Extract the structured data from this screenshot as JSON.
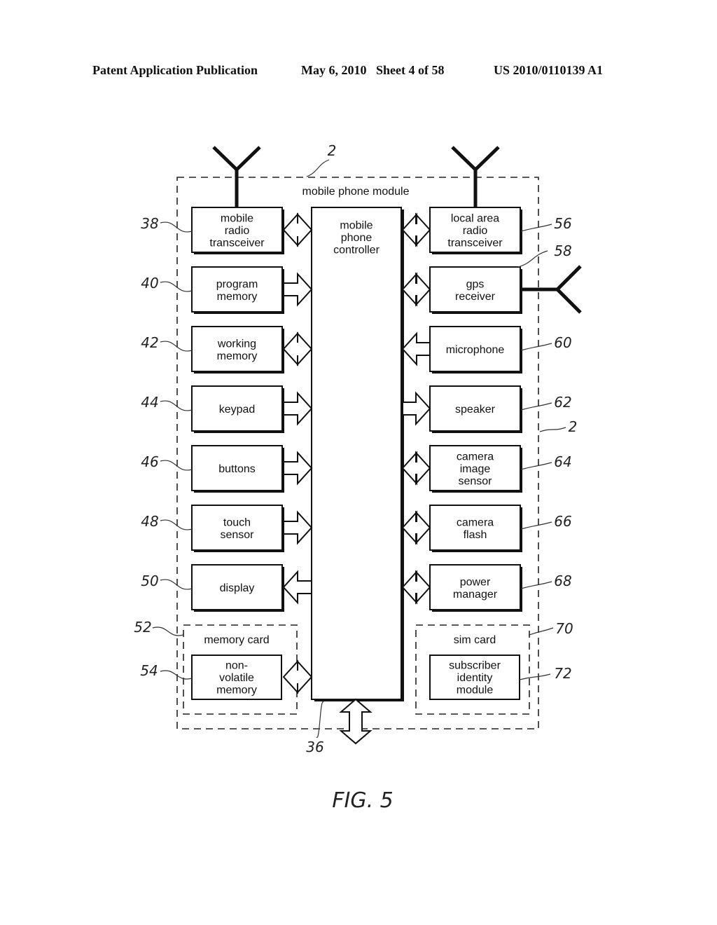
{
  "header": {
    "left": "Patent Application Publication",
    "date_sheet": "May 6, 2010   Sheet 4 of 58",
    "pub_number": "US 2010/0110139 A1"
  },
  "figure": {
    "caption": "FIG. 5",
    "module_title": "mobile phone module",
    "module_ref": "2",
    "module_ref_side": "2",
    "controller": {
      "lines": [
        "mobile",
        "phone",
        "controller"
      ],
      "ref": "36"
    },
    "left_blocks": [
      {
        "lines": [
          "mobile",
          "radio",
          "transceiver"
        ],
        "ref": "38",
        "arrow": "bidirectional",
        "antenna": true
      },
      {
        "lines": [
          "program",
          "memory"
        ],
        "ref": "40",
        "arrow": "to-controller"
      },
      {
        "lines": [
          "working",
          "memory"
        ],
        "ref": "42",
        "arrow": "bidirectional"
      },
      {
        "lines": [
          "keypad"
        ],
        "ref": "44",
        "arrow": "to-controller"
      },
      {
        "lines": [
          "buttons"
        ],
        "ref": "46",
        "arrow": "to-controller"
      },
      {
        "lines": [
          "touch",
          "sensor"
        ],
        "ref": "48",
        "arrow": "to-controller"
      },
      {
        "lines": [
          "display"
        ],
        "ref": "50",
        "arrow": "from-controller"
      }
    ],
    "right_blocks": [
      {
        "lines": [
          "local area",
          "radio",
          "transceiver"
        ],
        "ref": "56",
        "arrow": "bidirectional",
        "antenna": true
      },
      {
        "lines": [
          "gps",
          "receiver"
        ],
        "ref": "58",
        "arrow": "bidirectional",
        "antenna": true
      },
      {
        "lines": [
          "microphone"
        ],
        "ref": "60",
        "arrow": "to-controller"
      },
      {
        "lines": [
          "speaker"
        ],
        "ref": "62",
        "arrow": "from-controller"
      },
      {
        "lines": [
          "camera",
          "image",
          "sensor"
        ],
        "ref": "64",
        "arrow": "bidirectional"
      },
      {
        "lines": [
          "camera",
          "flash"
        ],
        "ref": "66",
        "arrow": "bidirectional"
      },
      {
        "lines": [
          "power",
          "manager"
        ],
        "ref": "68",
        "arrow": "bidirectional"
      }
    ],
    "memory_card": {
      "title": "memory card",
      "ref": "52",
      "block": {
        "lines": [
          "non-",
          "volatile",
          "memory"
        ],
        "ref": "54"
      }
    },
    "sim_card": {
      "title": "sim card",
      "ref": "70",
      "block": {
        "lines": [
          "subscriber",
          "identity",
          "module"
        ],
        "ref": "72"
      }
    }
  }
}
